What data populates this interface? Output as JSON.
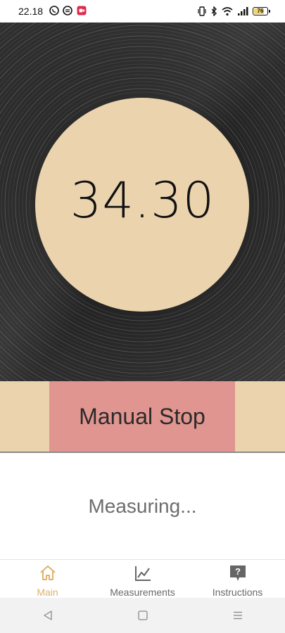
{
  "status_bar": {
    "time": "22.18",
    "battery_level": "76",
    "left_icons": [
      "whatsapp-icon",
      "message-icon",
      "screen-record-icon"
    ],
    "right_icons": [
      "vibrate-icon",
      "bluetooth-icon",
      "wifi-icon",
      "signal-icon",
      "battery-icon"
    ]
  },
  "timer": {
    "value": "34.30"
  },
  "actions": {
    "manual_stop_label": "Manual Stop"
  },
  "status": {
    "message": "Measuring..."
  },
  "bottom_nav": {
    "items": [
      {
        "label": "Main",
        "icon": "home-icon",
        "active": true
      },
      {
        "label": "Measurements",
        "icon": "chart-icon",
        "active": false
      },
      {
        "label": "Instructions",
        "icon": "help-icon",
        "active": false
      }
    ]
  },
  "system_nav": {
    "icons": [
      "back-icon",
      "home-square-icon",
      "recents-menu-icon"
    ]
  },
  "colors": {
    "accent": "#e0b36a",
    "record_label": "#ebd3ae",
    "stop_button": "#e09590",
    "record_body": "#2a2a2a"
  }
}
